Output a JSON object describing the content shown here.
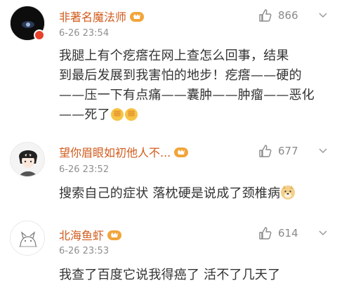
{
  "comments": [
    {
      "username": "非著名魔法师",
      "time": "6-26 23:54",
      "likes": "866",
      "lines": [
        "我腿上有个疙瘩在网上查怎么回事，结果",
        "到最后发展到我害怕的地步！疙瘩——硬的",
        "——压一下有点痛——囊肿——肿瘤——恶化",
        "——死了"
      ]
    },
    {
      "username": "望你眉眼如初他人不...",
      "time": "6-26 23:52",
      "likes": "677",
      "lines": [
        "搜索自己的症状 落枕硬是说成了颈椎病"
      ]
    },
    {
      "username": "北海鱼虾",
      "time": "6-26 23:53",
      "likes": "614",
      "lines": [
        "我查了百度它说我得癌了 活不了几天了"
      ]
    }
  ],
  "colors": {
    "username": "#d15b1d",
    "time": "#8f8f8f",
    "text": "#333333",
    "vip_badge": "#f1a53a",
    "avatar_badge": "#e8412c"
  },
  "icons": [
    "like-icon",
    "chevron-down-icon",
    "vip-badge-icon",
    "facepalm-emoji",
    "doge-emoji"
  ]
}
